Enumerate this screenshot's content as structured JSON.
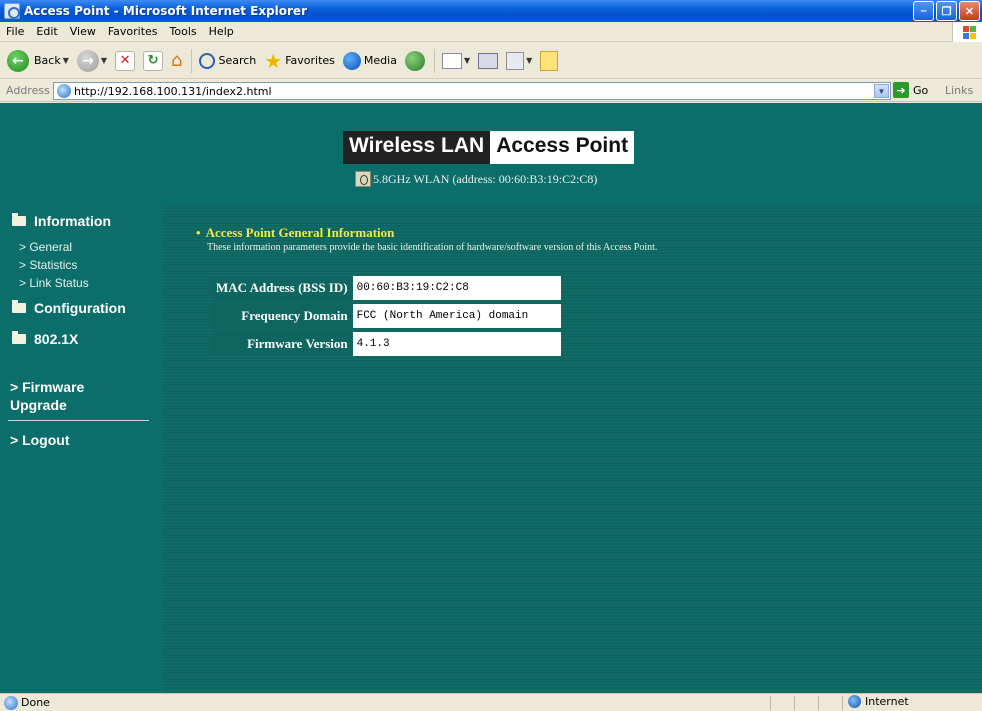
{
  "window": {
    "title": "Access Point - Microsoft Internet Explorer"
  },
  "menubar": {
    "items": [
      "File",
      "Edit",
      "View",
      "Favorites",
      "Tools",
      "Help"
    ]
  },
  "toolbar": {
    "back_label": "Back",
    "search_label": "Search",
    "favorites_label": "Favorites",
    "media_label": "Media"
  },
  "addressbar": {
    "label": "Address",
    "url": "http://192.168.100.131/index2.html",
    "go_label": "Go",
    "links_label": "Links"
  },
  "banner": {
    "logo_part1": "Wireless LAN",
    "logo_part2": "Access Point",
    "subline": "5.8GHz WLAN (address: 00:60:B3:19:C2:C8)"
  },
  "sidebar": {
    "information": "Information",
    "sub_items": [
      "> General",
      "> Statistics",
      "> Link Status"
    ],
    "configuration": "Configuration",
    "dot1x": "802.1X",
    "firmware_upgrade": "> Firmware\nUpgrade",
    "logout": "> Logout"
  },
  "content": {
    "section_title": "Access Point General Information",
    "section_desc": "These information parameters provide the basic identification of hardware/software version of this Access Point.",
    "rows": [
      {
        "label": "MAC Address (BSS ID)",
        "value": "00:60:B3:19:C2:C8"
      },
      {
        "label": "Frequency Domain",
        "value": "FCC (North America) domain"
      },
      {
        "label": "Firmware Version",
        "value": "4.1.3"
      }
    ]
  },
  "statusbar": {
    "status": "Done",
    "zone": "Internet"
  },
  "colors": {
    "page_bg": "#0c6e6a",
    "title_yellow": "#f4e84a",
    "xp_blue": "#0a5fd8"
  }
}
